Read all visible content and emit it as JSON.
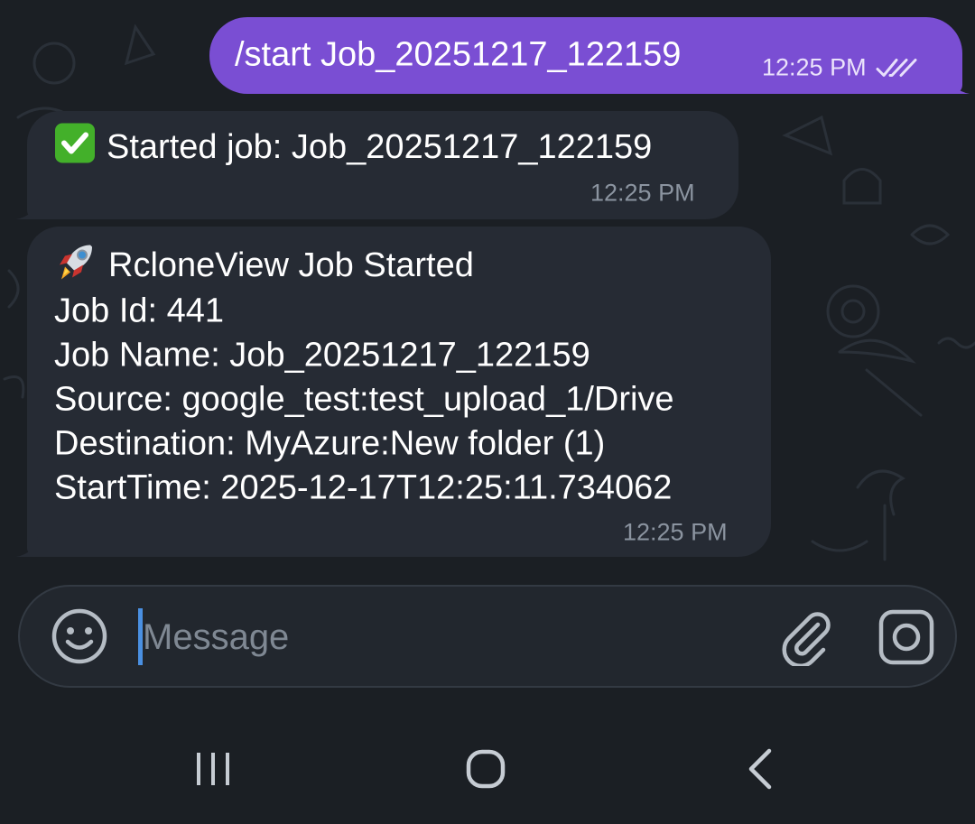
{
  "messages": {
    "outgoing": {
      "text": "/start Job_20251217_122159",
      "time": "12:25 PM",
      "status_icon": "double-check-icon"
    },
    "reply1": {
      "emoji": "✅",
      "text": "Started job: Job_20251217_122159",
      "time": "12:25 PM"
    },
    "reply2": {
      "emoji": "🚀",
      "title": "RcloneView Job Started",
      "lines": [
        "Job Id: 441",
        "Job Name: Job_20251217_122159",
        "Source: google_test:test_upload_1/Drive",
        "Destination: MyAzure:New folder (1)",
        "StartTime: 2025-12-17T12:25:11.734062"
      ],
      "time": "12:25 PM"
    }
  },
  "composer": {
    "placeholder": "Message",
    "value": "",
    "emoji_icon": "smiley-icon",
    "attach_icon": "paperclip-icon",
    "camera_icon": "camera-icon"
  },
  "system_nav": {
    "recents_icon": "recents-icon",
    "home_icon": "home-icon",
    "back_icon": "back-icon"
  },
  "colors": {
    "background": "#1b1f24",
    "outgoing_bubble": "#7a4ed3",
    "incoming_bubble": "#262b34",
    "caret": "#4a90e2"
  }
}
